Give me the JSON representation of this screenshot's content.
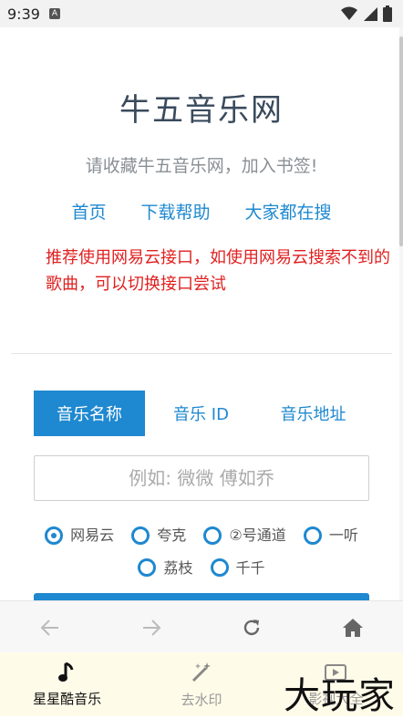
{
  "status_bar": {
    "time": "9:39",
    "notification_badge": "A"
  },
  "header": {
    "title": "牛五音乐网",
    "subtitle": "请收藏牛五音乐网，加入书签!"
  },
  "nav_links": [
    "首页",
    "下载帮助",
    "大家都在搜"
  ],
  "notice": "推荐使用网易云接口，如使用网易云搜索不到的歌曲，可以切换接口尝试",
  "search_tabs": [
    "音乐名称",
    "音乐 ID",
    "音乐地址"
  ],
  "search": {
    "placeholder": "例如: 微微 傅如乔",
    "value": ""
  },
  "sources": [
    {
      "label": "网易云",
      "checked": true
    },
    {
      "label": "夸克",
      "checked": false
    },
    {
      "label": "②号通道",
      "checked": false
    },
    {
      "label": "一听",
      "checked": false
    },
    {
      "label": "荔枝",
      "checked": false
    },
    {
      "label": "千千",
      "checked": false
    }
  ],
  "browser_nav": {
    "icons": [
      "arrow-left-icon",
      "arrow-right-icon",
      "refresh-icon",
      "home-icon"
    ]
  },
  "bottom_tabs": [
    {
      "label": "星星酷音乐",
      "icon": "music-note-icon",
      "active": true
    },
    {
      "label": "去水印",
      "icon": "magic-wand-icon",
      "active": false
    },
    {
      "label": "影视大全",
      "icon": "video-icon",
      "active": false
    }
  ],
  "watermark": "大玩家",
  "colors": {
    "accent": "#1e88d0",
    "notice": "#e02020",
    "title": "#3a4a5c"
  }
}
